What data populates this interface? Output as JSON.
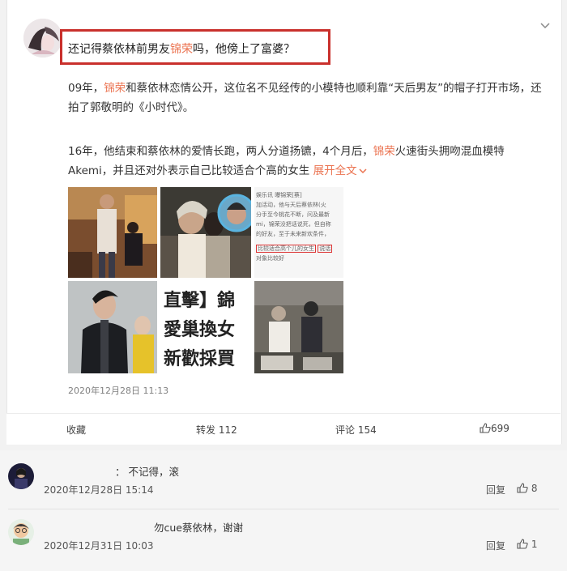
{
  "post": {
    "headline_pre": "还记得蔡依林前男友",
    "headline_name": "锦荣",
    "headline_post": "吗，他傍上了富婆？",
    "p1_a": "09年，",
    "p1_name": "锦荣",
    "p1_b": "和蔡依林恋情公开，这位名不见经传的小模特也顺利靠“天后男友”的帽子打开市场，还拍了郭敬明的《小时代》。",
    "p2_a": "16年，他结束和蔡依林的爱情长跑，两人分道扬镳，4个月后，",
    "p2_name": "锦荣",
    "p2_b": "火速街头拥吻混血模特Akemi，并且还对外表示自己比较适合个高的女生",
    "expand_label": "展开全文",
    "timestamp": "2020年12月28日 11:13",
    "photo_text": {
      "tv_line1": "直擊】錦",
      "tv_line2": "愛巢換女",
      "tv_line3": "新歡採買",
      "news_lines": [
        "娱乐讯 曝锦荣[蔡]",
        "加活动，他与天后蔡依林(火",
        "分手至今桃花不断，问及最新",
        "mi，锦荣没把话说死，但自称",
        "的好友，至于未来新欢条件，"
      ],
      "news_highlight": "比较适合高个儿的女生",
      "news_highlight2": "说话",
      "news_tail": "对象比较好"
    }
  },
  "actions": {
    "favorite": "收藏",
    "repost": "转发 112",
    "comment": "评论 154",
    "like": "699"
  },
  "comments": [
    {
      "text": "：  不记得，滚",
      "time": "2020年12月28日 15:14",
      "reply": "回复",
      "likes": "8"
    },
    {
      "text": "勿cue蔡依林，谢谢",
      "time": "2020年12月31日 10:03",
      "reply": "回复",
      "likes": "1"
    }
  ],
  "colors": {
    "accent": "#eb7350",
    "highlight_border": "#c9302c"
  }
}
